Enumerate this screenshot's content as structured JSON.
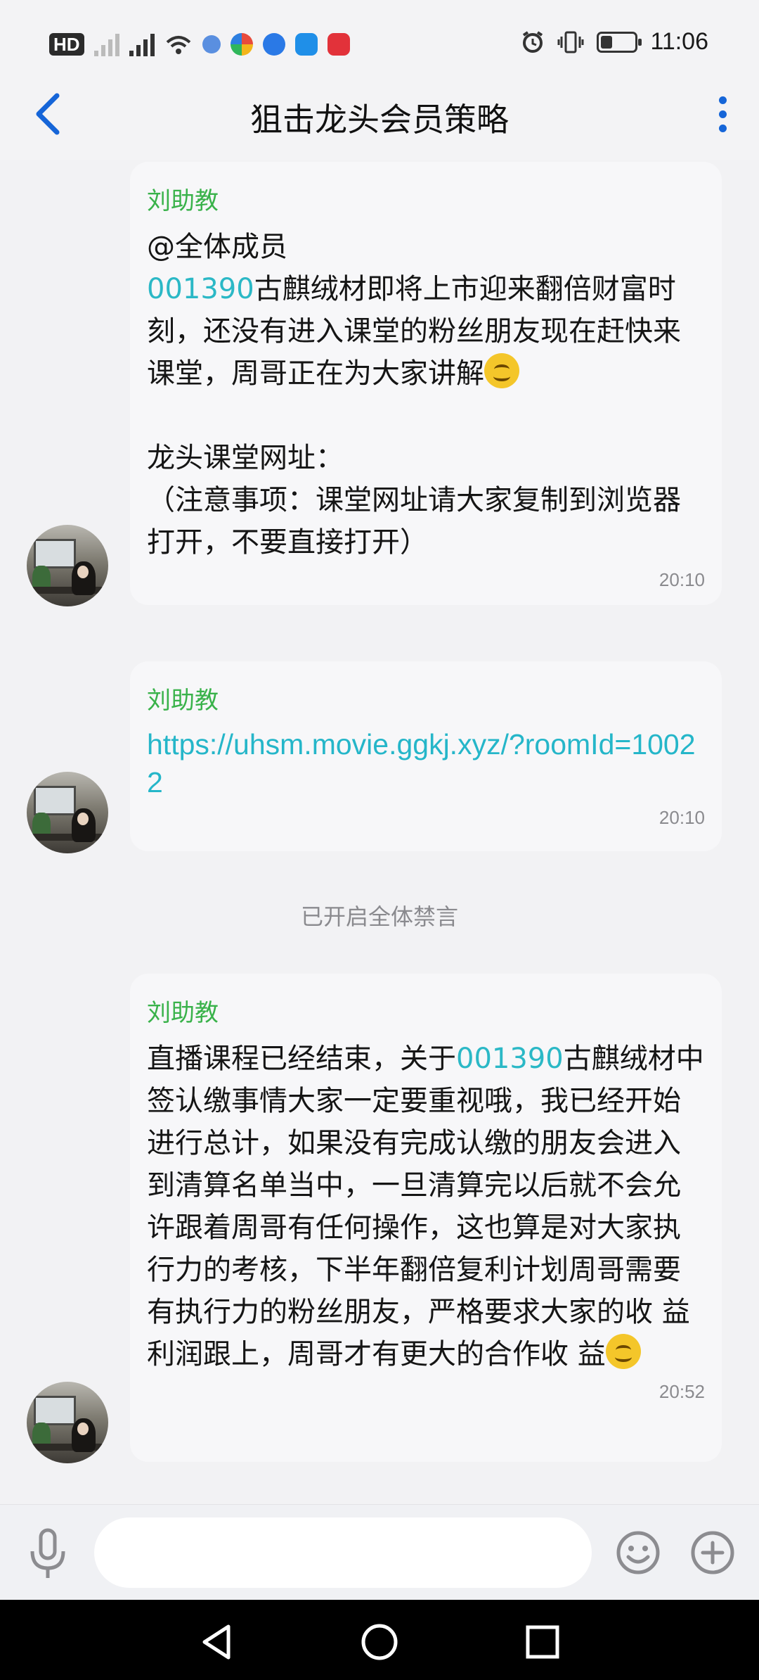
{
  "status_bar": {
    "hd_badge": "HD",
    "clock": "11:06",
    "battery_level": 0.35,
    "icons": [
      "hd-icon",
      "signal-icon",
      "signal-4g-icon",
      "wifi-icon",
      "app-icon",
      "app-icon",
      "app-icon",
      "app-icon",
      "app-icon",
      "alarm-icon",
      "vibrate-icon",
      "battery-icon"
    ]
  },
  "header": {
    "title": "狙击龙头会员策略",
    "back_icon": "chevron-left-icon",
    "more_icon": "more-vertical-icon"
  },
  "messages": [
    {
      "sender": "刘助教",
      "line1": "@全体成员",
      "code": "001390",
      "text_after_code": "古麒绒材即将上市迎来翻倍财富时刻，还没有进入课堂的粉丝朋友现在赶快来课堂，周哥正在为大家讲解",
      "emoji": "smiling-face-icon",
      "tail": "\n\n龙头课堂网址：\n（注意事项：课堂网址请大家复制到浏览器打开，不要直接打开）",
      "time": "20:10"
    },
    {
      "sender": "刘助教",
      "link": "https://uhsm.movie.ggkj.xyz/?roomId=10022",
      "time": "20:10"
    },
    {
      "sender": "刘助教",
      "text_before_code": "直播课程已经结束，关于",
      "code": "001390",
      "text_after_code": "古麒绒材中签认缴事情大家一定要重视哦，我已经开始进行总计，如果没有完成认缴的朋友会进入到清算名单当中，一旦清算完以后就不会允许跟着周哥有任何操作，这也算是对大家执行力的考核，下半年翻倍复利计划周哥需要有执行力的粉丝朋友，严格要求大家的收 益利润跟上，周哥才有更大的合作收 益",
      "emoji": "smiling-face-icon",
      "time": "20:52"
    }
  ],
  "system_notice": "已开启全体禁言",
  "input_bar": {
    "placeholder": "",
    "mic_icon": "microphone-icon",
    "emoji_icon": "emoji-icon",
    "plus_icon": "plus-circle-icon"
  },
  "nav_bar": {
    "icons": [
      "back-triangle-icon",
      "home-circle-icon",
      "recents-square-icon"
    ]
  },
  "colors": {
    "accent_blue": "#1565d8",
    "sender_green": "#39b24a",
    "code_cyan": "#2bb8c6"
  }
}
